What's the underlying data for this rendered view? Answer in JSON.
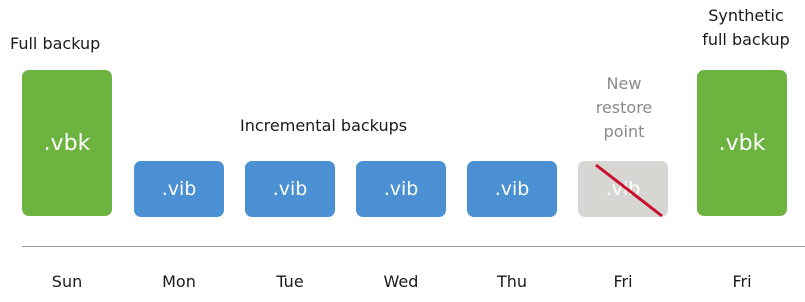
{
  "labels": {
    "full_backup": "Full backup",
    "incremental_backups": "Incremental backups",
    "new_restore_point": [
      "New",
      "restore",
      "point"
    ],
    "synthetic_full_backup": [
      "Synthetic",
      "full backup"
    ]
  },
  "boxes": {
    "full": ".vbk",
    "inc1": ".vib",
    "inc2": ".vib",
    "inc3": ".vib",
    "inc4": ".vib",
    "removed": ".vib",
    "synthetic": ".vbk"
  },
  "days": [
    "Sun",
    "Mon",
    "Tue",
    "Wed",
    "Thu",
    "Fri",
    "Fri"
  ],
  "colors": {
    "full": "#6cb33f",
    "incremental": "#4a90d2",
    "removed_box": "#d8d6d2",
    "removed_text": "#8a8a8a",
    "strike": "#c8102e",
    "axis": "#9a9a9a"
  }
}
